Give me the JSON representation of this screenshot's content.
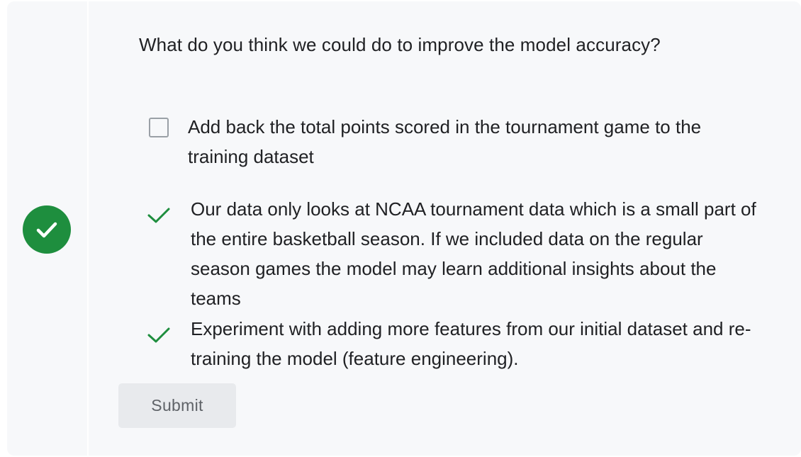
{
  "question": {
    "text": "What do you think we could do to improve the model accuracy?"
  },
  "status": {
    "icon": "check-circle-icon",
    "color": "#1e8e3e"
  },
  "options": [
    {
      "text": "Add back the total points scored in the tournament game to the training dataset",
      "state": "unchecked"
    },
    {
      "text": "Our data only looks at NCAA tournament data which is a small part of the entire basketball season. If we included data on the regular season games the model may learn additional insights about the teams",
      "state": "correct"
    },
    {
      "text": "Experiment with adding more features from our initial dataset and re-training the model (feature engineering).",
      "state": "correct"
    }
  ],
  "submit": {
    "label": "Submit"
  }
}
